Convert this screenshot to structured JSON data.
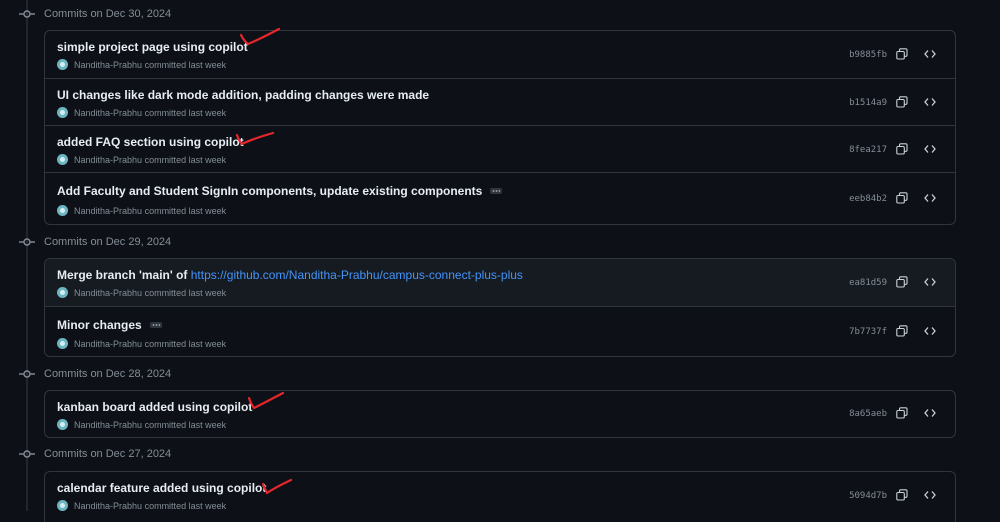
{
  "groups": [
    {
      "title": "Commits on Dec 30, 2024",
      "commits": [
        {
          "title": "simple project page using copilot",
          "author": "Nanditha-Prabhu",
          "time": "committed last week",
          "sha": "b9885fb"
        },
        {
          "title": "UI changes like dark mode addition, padding changes were made",
          "author": "Nanditha-Prabhu",
          "time": "committed last week",
          "sha": "b1514a9"
        },
        {
          "title": "added FAQ section using copilot",
          "author": "Nanditha-Prabhu",
          "time": "committed last week",
          "sha": "8fea217"
        },
        {
          "title": "Add Faculty and Student SignIn components, update existing components",
          "author": "Nanditha-Prabhu",
          "time": "committed last week",
          "sha": "eeb84b2"
        }
      ]
    },
    {
      "title": "Commits on Dec 29, 2024",
      "commits": [
        {
          "title": "Merge branch 'main' of",
          "link": "https://github.com/Nanditha-Prabhu/campus-connect-plus-plus",
          "author": "Nanditha-Prabhu",
          "time": "committed last week",
          "sha": "ea81d59"
        },
        {
          "title": "Minor changes",
          "author": "Nanditha-Prabhu",
          "time": "committed last week",
          "sha": "7b7737f"
        }
      ]
    },
    {
      "title": "Commits on Dec 28, 2024",
      "commits": [
        {
          "title": "kanban board added using copilot",
          "author": "Nanditha-Prabhu",
          "time": "committed last week",
          "sha": "8a65aeb"
        }
      ]
    },
    {
      "title": "Commits on Dec 27, 2024",
      "commits": [
        {
          "title": "calendar feature added using copilot",
          "author": "Nanditha-Prabhu",
          "time": "committed last week",
          "sha": "5094d7b"
        }
      ]
    }
  ],
  "icons": {
    "commit": "git-commit-icon",
    "copy": "copy-icon",
    "browse": "code-icon",
    "ellipsis": "kebab-ellipsis-icon",
    "check": "handwritten-check-mark"
  },
  "colors": {
    "background": "#0d1117",
    "border": "#30363d",
    "link": "#4493f8",
    "muted": "#848d97",
    "check": "#e5262b"
  }
}
